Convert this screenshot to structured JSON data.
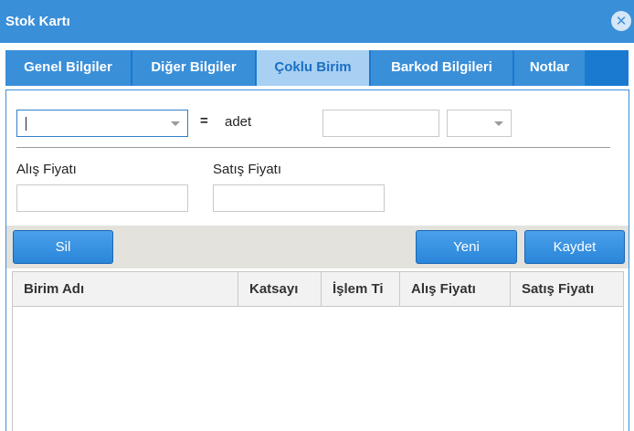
{
  "window": {
    "title": "Stok Kartı",
    "close_glyph": "✕"
  },
  "tabs": [
    {
      "label": "Genel Bilgiler",
      "active": false
    },
    {
      "label": "Diğer Bilgiler",
      "active": false
    },
    {
      "label": "Çoklu Birim",
      "active": true
    },
    {
      "label": "Barkod Bilgileri",
      "active": false
    },
    {
      "label": "Notlar",
      "active": false
    }
  ],
  "form": {
    "unit_select_value": "",
    "equals_sign": "=",
    "base_unit_label": "adet",
    "factor_value": "",
    "secondary_select_value": "",
    "purchase_price_label": "Alış Fiyatı",
    "purchase_price_value": "",
    "sale_price_label": "Satış Fiyatı",
    "sale_price_value": ""
  },
  "toolbar": {
    "delete_label": "Sil",
    "new_label": "Yeni",
    "save_label": "Kaydet"
  },
  "grid": {
    "columns": [
      "Birim Adı",
      "Katsayı",
      "İşlem Ti",
      "Alış Fiyatı",
      "Satış Fiyatı"
    ],
    "rows": []
  },
  "colors": {
    "titlebar": "#3a8fd9",
    "tab_active": "#a8d0f2",
    "button": "#2a86da"
  }
}
